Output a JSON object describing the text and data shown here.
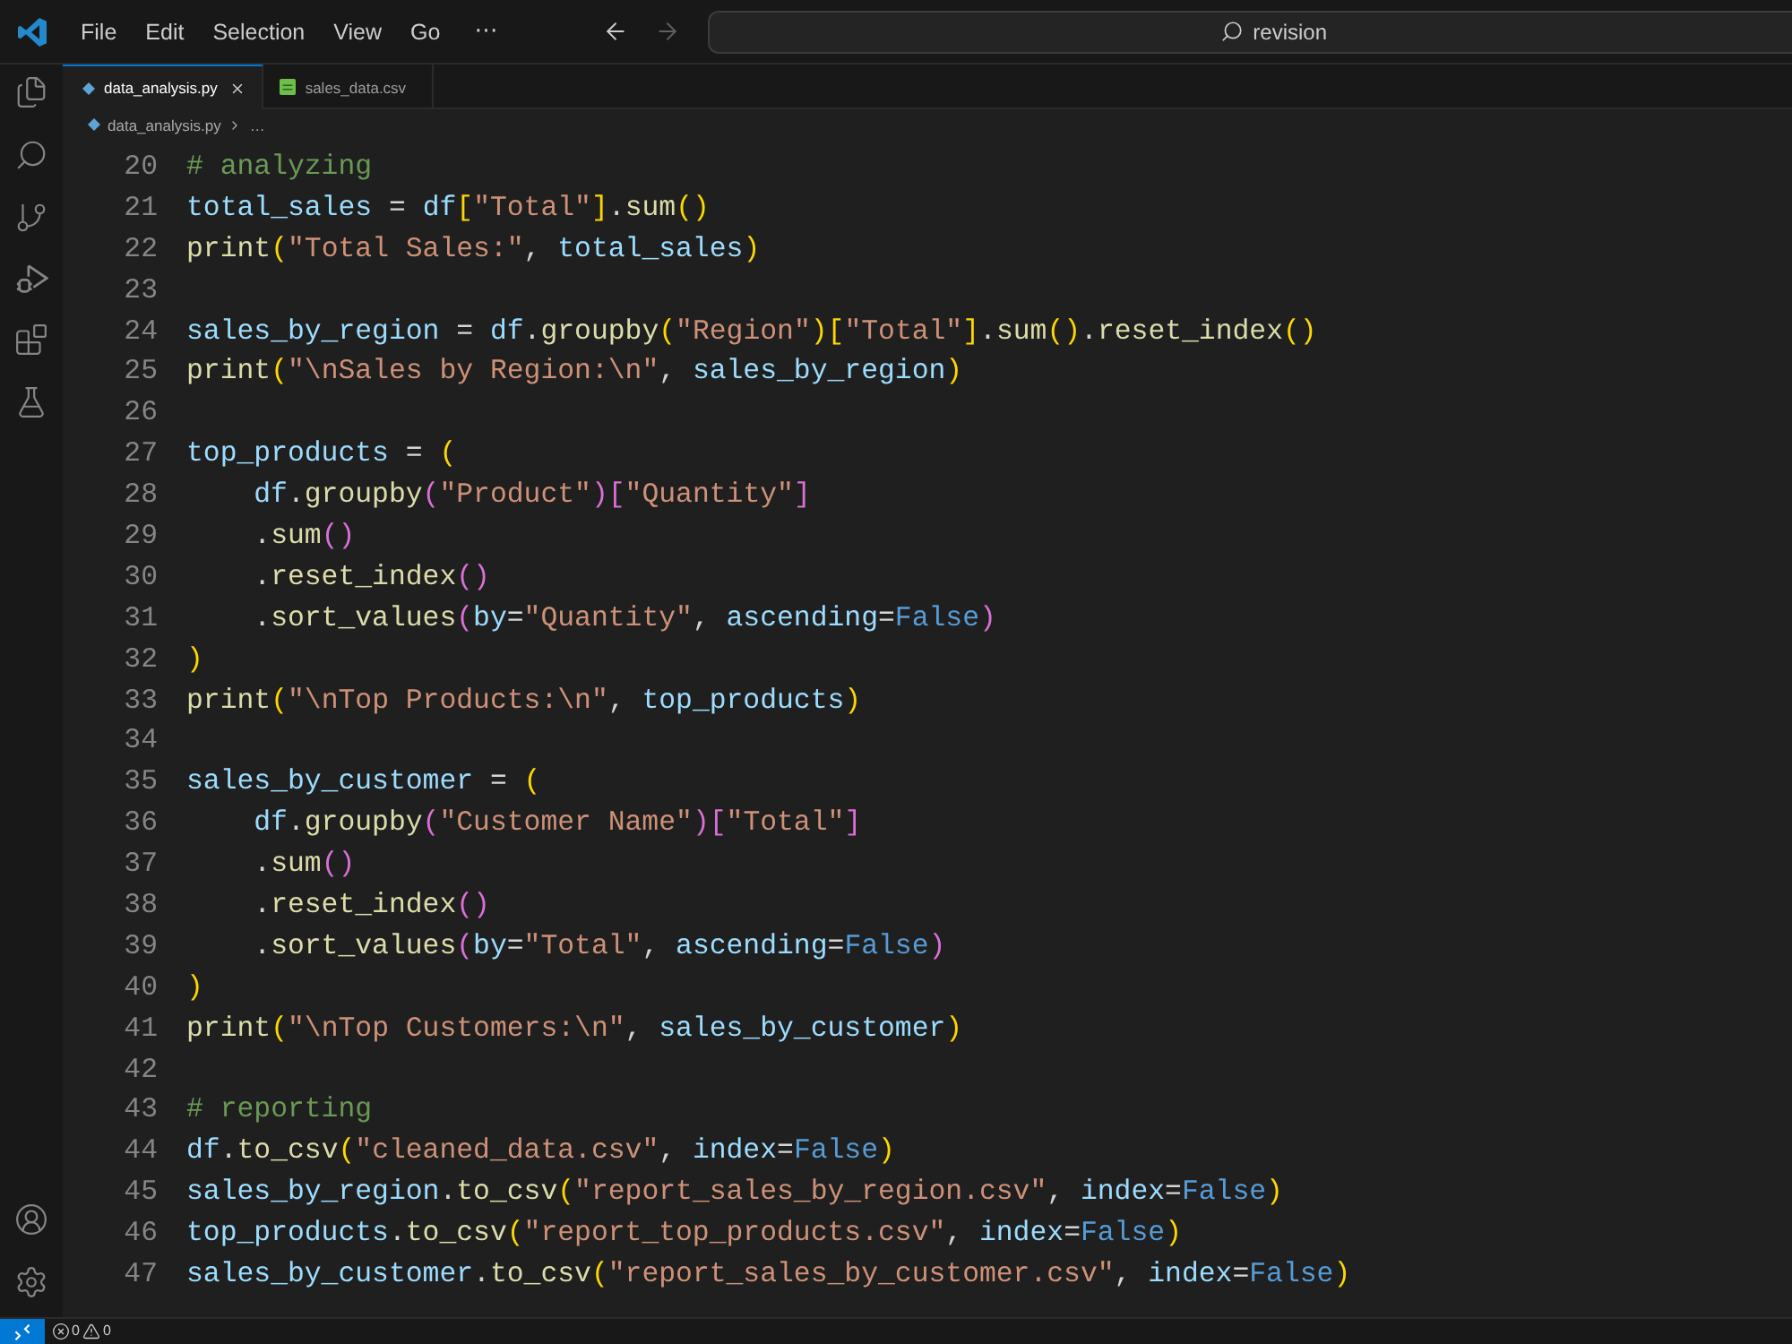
{
  "title_bar": {
    "menu": [
      "File",
      "Edit",
      "Selection",
      "View",
      "Go"
    ],
    "overflow": "⋯",
    "navigation": [
      {
        "kind": "back",
        "disabled": false
      },
      {
        "kind": "forward",
        "disabled": true
      }
    ],
    "command_center": "revision"
  },
  "tabs": [
    {
      "label": "data_analysis.py",
      "kind": "python",
      "selected": true
    },
    {
      "label": "sales_data.csv",
      "kind": "csv",
      "selected": false
    }
  ],
  "breadcrumb": {
    "file": "data_analysis.py",
    "kind": "python",
    "symbol": "…"
  },
  "editor": {
    "lines": [
      {
        "number": "20",
        "tokens": [
          {
            "kind": "comment",
            "text": "# analyzing"
          }
        ]
      },
      {
        "number": "21",
        "tokens": [
          {
            "kind": "variable",
            "text": "total_sales"
          },
          {
            "kind": "operator",
            "text": " = "
          },
          {
            "kind": "variable",
            "text": "df"
          },
          {
            "kind": "bracket",
            "text": "["
          },
          {
            "kind": "string",
            "text": "\"Total\""
          },
          {
            "kind": "bracket",
            "text": "]"
          },
          {
            "kind": "punctuation",
            "text": "."
          },
          {
            "kind": "function",
            "text": "sum"
          },
          {
            "kind": "bracket",
            "text": "()"
          }
        ]
      },
      {
        "number": "22",
        "tokens": [
          {
            "kind": "function",
            "text": "print"
          },
          {
            "kind": "bracket",
            "text": "("
          },
          {
            "kind": "string",
            "text": "\"Total Sales:\""
          },
          {
            "kind": "punctuation",
            "text": ", "
          },
          {
            "kind": "variable",
            "text": "total_sales"
          },
          {
            "kind": "bracket",
            "text": ")"
          }
        ]
      },
      {
        "number": "23"
      },
      {
        "number": "24",
        "tokens": [
          {
            "kind": "variable",
            "text": "sales_by_region"
          },
          {
            "kind": "operator",
            "text": " = "
          },
          {
            "kind": "variable",
            "text": "df"
          },
          {
            "kind": "punctuation",
            "text": "."
          },
          {
            "kind": "function",
            "text": "groupby"
          },
          {
            "kind": "bracket",
            "text": "("
          },
          {
            "kind": "string",
            "text": "\"Region\""
          },
          {
            "kind": "bracket",
            "text": ")"
          },
          {
            "kind": "bracket",
            "text": "["
          },
          {
            "kind": "string",
            "text": "\"Total\""
          },
          {
            "kind": "bracket",
            "text": "]"
          },
          {
            "kind": "punctuation",
            "text": "."
          },
          {
            "kind": "function",
            "text": "sum"
          },
          {
            "kind": "bracket",
            "text": "()"
          },
          {
            "kind": "punctuation",
            "text": "."
          },
          {
            "kind": "function",
            "text": "reset_index"
          },
          {
            "kind": "bracket",
            "text": "()"
          }
        ]
      },
      {
        "number": "25",
        "tokens": [
          {
            "kind": "function",
            "text": "print"
          },
          {
            "kind": "bracket",
            "text": "("
          },
          {
            "kind": "string",
            "text": "\"\\nSales by Region:\\n\""
          },
          {
            "kind": "punctuation",
            "text": ", "
          },
          {
            "kind": "variable",
            "text": "sales_by_region"
          },
          {
            "kind": "bracket",
            "text": ")"
          }
        ]
      },
      {
        "number": "26"
      },
      {
        "number": "27",
        "tokens": [
          {
            "kind": "variable",
            "text": "top_products"
          },
          {
            "kind": "operator",
            "text": " = "
          },
          {
            "kind": "bracket",
            "text": "("
          }
        ],
        "children": [
          {
            "number": "28",
            "tokens": [
              {
                "kind": "variable",
                "text": "df"
              },
              {
                "kind": "punctuation",
                "text": "."
              },
              {
                "kind": "function",
                "text": "groupby"
              },
              {
                "kind": "bracket",
                "text": "("
              },
              {
                "kind": "string",
                "text": "\"Product\""
              },
              {
                "kind": "bracket",
                "text": ")"
              },
              {
                "kind": "bracket",
                "text": "["
              },
              {
                "kind": "string",
                "text": "\"Quantity\""
              },
              {
                "kind": "bracket",
                "text": "]"
              }
            ]
          },
          {
            "number": "29",
            "tokens": [
              {
                "kind": "punctuation",
                "text": "."
              },
              {
                "kind": "function",
                "text": "sum"
              },
              {
                "kind": "bracket",
                "text": "()"
              }
            ]
          },
          {
            "number": "30",
            "tokens": [
              {
                "kind": "punctuation",
                "text": "."
              },
              {
                "kind": "function",
                "text": "reset_index"
              },
              {
                "kind": "bracket",
                "text": "()"
              }
            ]
          },
          {
            "number": "31",
            "tokens": [
              {
                "kind": "punctuation",
                "text": "."
              },
              {
                "kind": "function",
                "text": "sort_values"
              },
              {
                "kind": "bracket",
                "text": "("
              },
              {
                "kind": "parameter",
                "text": "by"
              },
              {
                "kind": "operator",
                "text": "="
              },
              {
                "kind": "string",
                "text": "\"Quantity\""
              },
              {
                "kind": "punctuation",
                "text": ", "
              },
              {
                "kind": "parameter",
                "text": "ascending"
              },
              {
                "kind": "operator",
                "text": "="
              },
              {
                "kind": "constant",
                "text": "False"
              },
              {
                "kind": "bracket",
                "text": ")"
              }
            ]
          }
        ]
      },
      {
        "number": "32",
        "tokens": [
          {
            "kind": "bracket",
            "text": ")"
          }
        ]
      },
      {
        "number": "33",
        "tokens": [
          {
            "kind": "function",
            "text": "print"
          },
          {
            "kind": "bracket",
            "text": "("
          },
          {
            "kind": "string",
            "text": "\"\\nTop Products:\\n\""
          },
          {
            "kind": "punctuation",
            "text": ", "
          },
          {
            "kind": "variable",
            "text": "top_products"
          },
          {
            "kind": "bracket",
            "text": ")"
          }
        ]
      },
      {
        "number": "34"
      },
      {
        "number": "35",
        "tokens": [
          {
            "kind": "variable",
            "text": "sales_by_customer"
          },
          {
            "kind": "operator",
            "text": " = "
          },
          {
            "kind": "bracket",
            "text": "("
          }
        ],
        "children": [
          {
            "number": "36",
            "tokens": [
              {
                "kind": "variable",
                "text": "df"
              },
              {
                "kind": "punctuation",
                "text": "."
              },
              {
                "kind": "function",
                "text": "groupby"
              },
              {
                "kind": "bracket",
                "text": "("
              },
              {
                "kind": "string",
                "text": "\"Customer Name\""
              },
              {
                "kind": "bracket",
                "text": ")"
              },
              {
                "kind": "bracket",
                "text": "["
              },
              {
                "kind": "string",
                "text": "\"Total\""
              },
              {
                "kind": "bracket",
                "text": "]"
              }
            ]
          },
          {
            "number": "37",
            "tokens": [
              {
                "kind": "punctuation",
                "text": "."
              },
              {
                "kind": "function",
                "text": "sum"
              },
              {
                "kind": "bracket",
                "text": "()"
              }
            ]
          },
          {
            "number": "38",
            "tokens": [
              {
                "kind": "punctuation",
                "text": "."
              },
              {
                "kind": "function",
                "text": "reset_index"
              },
              {
                "kind": "bracket",
                "text": "()"
              }
            ]
          },
          {
            "number": "39",
            "tokens": [
              {
                "kind": "punctuation",
                "text": "."
              },
              {
                "kind": "function",
                "text": "sort_values"
              },
              {
                "kind": "bracket",
                "text": "("
              },
              {
                "kind": "parameter",
                "text": "by"
              },
              {
                "kind": "operator",
                "text": "="
              },
              {
                "kind": "string",
                "text": "\"Total\""
              },
              {
                "kind": "punctuation",
                "text": ", "
              },
              {
                "kind": "parameter",
                "text": "ascending"
              },
              {
                "kind": "operator",
                "text": "="
              },
              {
                "kind": "constant",
                "text": "False"
              },
              {
                "kind": "bracket",
                "text": ")"
              }
            ]
          }
        ]
      },
      {
        "number": "40",
        "tokens": [
          {
            "kind": "bracket",
            "text": ")"
          }
        ]
      },
      {
        "number": "41",
        "tokens": [
          {
            "kind": "function",
            "text": "print"
          },
          {
            "kind": "bracket",
            "text": "("
          },
          {
            "kind": "string",
            "text": "\"\\nTop Customers:\\n\""
          },
          {
            "kind": "punctuation",
            "text": ", "
          },
          {
            "kind": "variable",
            "text": "sales_by_customer"
          },
          {
            "kind": "bracket",
            "text": ")"
          }
        ]
      },
      {
        "number": "42"
      },
      {
        "number": "43",
        "tokens": [
          {
            "kind": "comment",
            "text": "# reporting"
          }
        ]
      },
      {
        "number": "44",
        "tokens": [
          {
            "kind": "variable",
            "text": "df"
          },
          {
            "kind": "punctuation",
            "text": "."
          },
          {
            "kind": "function",
            "text": "to_csv"
          },
          {
            "kind": "bracket",
            "text": "("
          },
          {
            "kind": "string",
            "text": "\"cleaned_data.csv\""
          },
          {
            "kind": "punctuation",
            "text": ", "
          },
          {
            "kind": "parameter",
            "text": "index"
          },
          {
            "kind": "operator",
            "text": "="
          },
          {
            "kind": "constant",
            "text": "False"
          },
          {
            "kind": "bracket",
            "text": ")"
          }
        ]
      },
      {
        "number": "45",
        "tokens": [
          {
            "kind": "variable",
            "text": "sales_by_region"
          },
          {
            "kind": "punctuation",
            "text": "."
          },
          {
            "kind": "function",
            "text": "to_csv"
          },
          {
            "kind": "bracket",
            "text": "("
          },
          {
            "kind": "string",
            "text": "\"report_sales_by_region.csv\""
          },
          {
            "kind": "punctuation",
            "text": ", "
          },
          {
            "kind": "parameter",
            "text": "index"
          },
          {
            "kind": "operator",
            "text": "="
          },
          {
            "kind": "constant",
            "text": "False"
          },
          {
            "kind": "bracket",
            "text": ")"
          }
        ]
      },
      {
        "number": "46",
        "tokens": [
          {
            "kind": "variable",
            "text": "top_products"
          },
          {
            "kind": "punctuation",
            "text": "."
          },
          {
            "kind": "function",
            "text": "to_csv"
          },
          {
            "kind": "bracket",
            "text": "("
          },
          {
            "kind": "string",
            "text": "\"report_top_products.csv\""
          },
          {
            "kind": "punctuation",
            "text": ", "
          },
          {
            "kind": "parameter",
            "text": "index"
          },
          {
            "kind": "operator",
            "text": "="
          },
          {
            "kind": "constant",
            "text": "False"
          },
          {
            "kind": "bracket",
            "text": ")"
          }
        ]
      },
      {
        "number": "47",
        "tokens": [
          {
            "kind": "variable",
            "text": "sales_by_customer"
          },
          {
            "kind": "punctuation",
            "text": "."
          },
          {
            "kind": "function",
            "text": "to_csv"
          },
          {
            "kind": "bracket",
            "text": "("
          },
          {
            "kind": "string",
            "text": "\"report_sales_by_customer.csv\""
          },
          {
            "kind": "punctuation",
            "text": ", "
          },
          {
            "kind": "parameter",
            "text": "index"
          },
          {
            "kind": "operator",
            "text": "="
          },
          {
            "kind": "constant",
            "text": "False"
          },
          {
            "kind": "bracket",
            "text": ")"
          }
        ]
      }
    ]
  },
  "status_bar": {
    "errors": "0",
    "warnings": "0"
  }
}
